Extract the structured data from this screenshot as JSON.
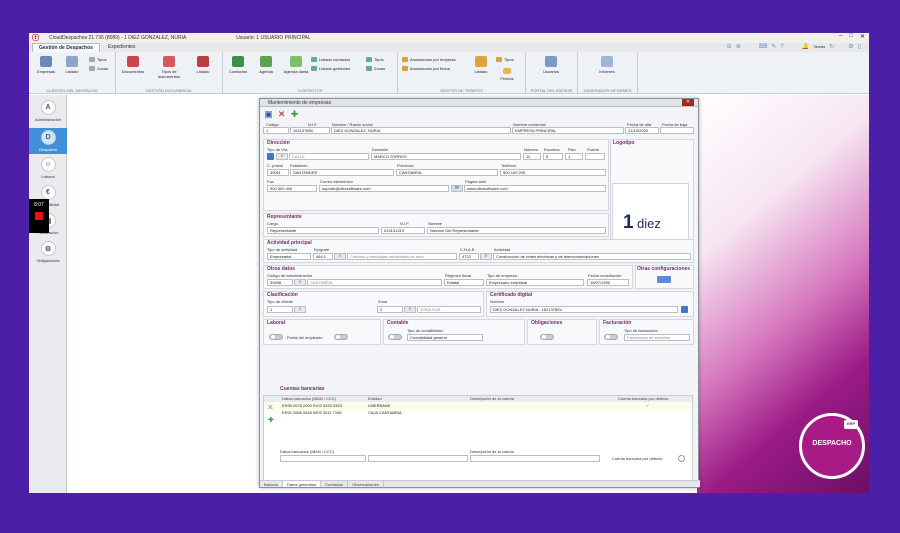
{
  "app": {
    "title": "CloudDespachos 21.736 (8089) - 1 DIEZ GONZALEZ, NURIA",
    "user": "Usuario: 1 USUARIO PRINCIPAL",
    "tabs": [
      "Gestión de Despachos",
      "Expedientes"
    ],
    "notify_label": "Tareas"
  },
  "ribbon": {
    "buttons": [
      "Empresas",
      "Listado",
      "Documentos",
      "Tipos de documentos",
      "Listado",
      "Contactos",
      "Agenda",
      "Agenda diaria",
      "Listado",
      "Listado",
      "Precios",
      "Usuarios",
      "Informes"
    ],
    "small": [
      "Tipos",
      "Zonas",
      "Listado contactos",
      "Listado gestiones",
      "Tipos",
      "Zonas",
      "Anotaciones por empresa",
      "Anotaciones por fecha",
      "Tipos"
    ],
    "groups": [
      "CLIENTES DEL DESPACHO",
      "GESTIÓN DOCUMENTAL",
      "CONTACTOS",
      "GESTOR DE TIEMPOS",
      "PORTAL DEL ASESOR",
      "GENERADOR INFORMES"
    ]
  },
  "sidebar": {
    "items": [
      {
        "letter": "A",
        "label": "Administración"
      },
      {
        "letter": "D",
        "label": "Despacho"
      },
      {
        "letter": "",
        "label": "Laboral"
      },
      {
        "letter": "",
        "label": "Contabilidad"
      },
      {
        "letter": "",
        "label": "Facturación"
      },
      {
        "letter": "",
        "label": "Obligaciones"
      }
    ],
    "clock": "8:07"
  },
  "dialog": {
    "title": "Mantenimiento de empresas",
    "labels": {
      "codigo": "Código",
      "nif": "N.I.F.",
      "nombre": "Nombre / Razón social",
      "comercial": "Nombre comercial",
      "alta": "Fecha de alta",
      "baja": "Fecha de baja",
      "direccion": "Dirección",
      "tipovia": "Tipo de Vía",
      "domicilio": "Domicilio",
      "numero": "Número",
      "escalera": "Escalera",
      "piso": "Piso",
      "puerta": "Puerta",
      "cpostal": "C. postal",
      "poblacion": "Población",
      "provincia": "Provincia",
      "telefono": "Teléfono",
      "fax": "Fax",
      "email": "Correo electrónico",
      "web": "Página web",
      "logotipo": "Logotipo",
      "representante": "Representante",
      "cargo": "Cargo",
      "rep_nif": "N.I.F.",
      "rep_nombre": "Nombre",
      "actividad": "Actividad principal",
      "tipoact": "Tipo de actividad",
      "epigrafe": "Epígrafe",
      "cnae": "C.N.A.E.",
      "act": "Actividad",
      "otros": "Otros datos",
      "codadm": "Código de administración",
      "regimen": "Régimen fiscal",
      "tipoemp": "Tipo de empresa",
      "fconst": "Fecha constitución",
      "otrascfg": "Otras configuraciones",
      "clasif": "Clasificación",
      "tipocli": "Tipo de cliente",
      "zona": "Zona",
      "cert": "Certificado digital",
      "certnombre": "Nombre",
      "laboral": "Laboral",
      "portal": "Portal del empleado",
      "contable": "Contable",
      "tipocont": "Tipo de contabilidad",
      "oblig": "Obligaciones",
      "factura": "Facturación",
      "tipofact": "Tipo de facturación",
      "cuentas": "Cuentas bancarias",
      "datos": "Datos bancarios (IBAN / CCC)",
      "entidad": "Entidad",
      "desc": "Descripción de la cuenta",
      "defecto": "Cuenta bancaria por defecto"
    },
    "values": {
      "codigo": "1",
      "nif": "16213785V",
      "nombre": "DIEZ GONZALEZ, NURIA",
      "comercial": "EMPRESA PRINCIPAL",
      "alta": "21/10/2020",
      "baja": "",
      "tipovia_code": "CALLE",
      "domicilio": "MARCO TORRES",
      "numero": "11",
      "escalera": "5",
      "piso": "1",
      "puerta": "",
      "cpostal": "39011",
      "poblacion": "SANTANDER",
      "provincia": "CANTABRIA",
      "telefono": "900 100 200",
      "fax": "900 300 400",
      "email": "soporte@diezsoftware.com",
      "web": "www.diezsoftware.com",
      "cargo": "Representante",
      "rep_nif": "01313131S",
      "rep_nombre": "Nombre Del Representante",
      "tipoact": "Empresarial",
      "epigrafe": "464.1",
      "epigrafe_desc": "Cobrado y embalajes industriales de mad",
      "cnae": "4722",
      "act": "Construcción de redes eléctricas y de telecomunicaciones",
      "codadm": "39408",
      "codadm_desc": "CANTABRIA",
      "regimen": "Estatal",
      "tipoemp": "Empresario individual",
      "fconst": "15/07/1990",
      "tipocli": "1",
      "zona": "2",
      "zona_desc": "ZONA SUR",
      "certnombre": "DIEZ GONZALEZ NURIA - 16213785V",
      "tipocont": "Contabilidad general",
      "tipofact": "Facturación de servicios"
    },
    "bank_rows": [
      {
        "iban": "ES99 2078 2000 9102 3333 3333",
        "entidad": "LIBERBANK",
        "desc": "",
        "default": "✓"
      },
      {
        "iban": "ES94 2066 0045 0002 0011 7196",
        "entidad": "CAJA CANTABRIA",
        "desc": "",
        "default": ""
      }
    ],
    "logo_text": {
      "mark": "1",
      "word": "diez"
    },
    "bottom_tabs": [
      "Básicos",
      "Datos generales",
      "Contactos",
      "Observaciones"
    ]
  },
  "brand": {
    "bubble": "DESPACHO",
    "erp": "ERP",
    "footer": "1 d"
  }
}
